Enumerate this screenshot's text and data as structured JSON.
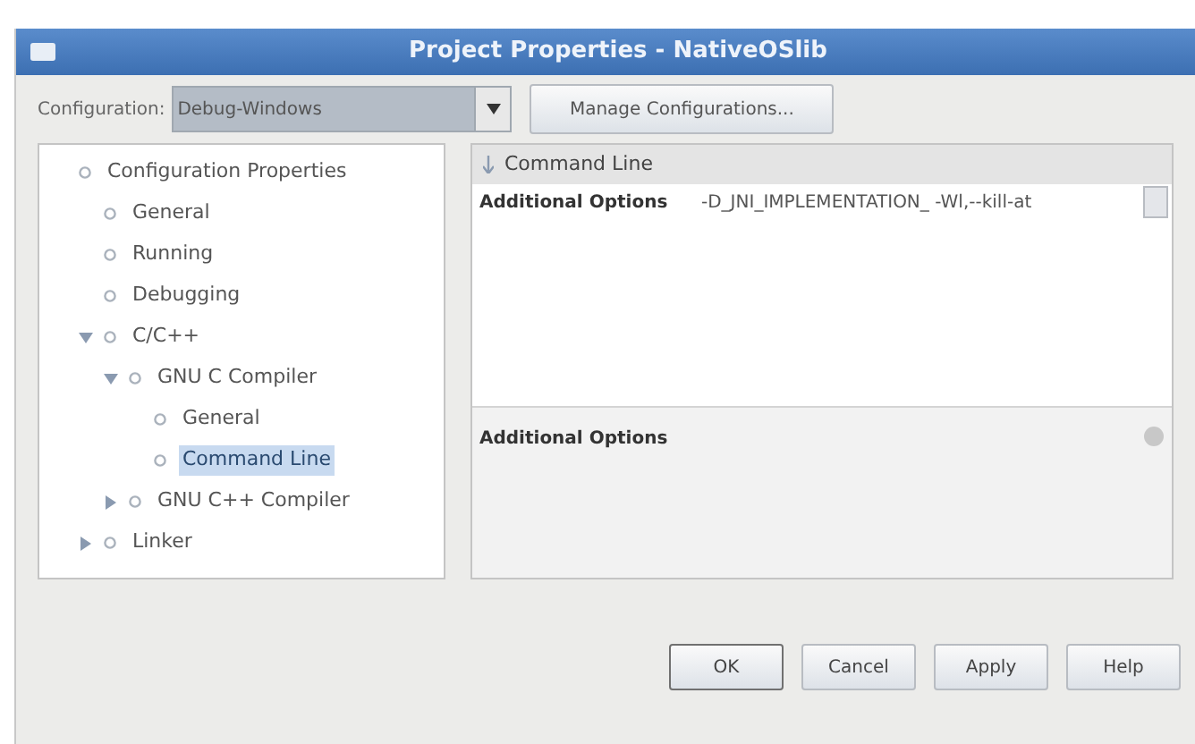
{
  "window": {
    "title": "Project Properties - NativeOSlib"
  },
  "configuration": {
    "label": "Configuration:",
    "value": "Debug-Windows",
    "manage_button": "Manage Configurations..."
  },
  "tree": [
    {
      "label": "Configuration Properties",
      "selected": false,
      "children": [
        {
          "label": "General",
          "selected": false
        },
        {
          "label": "Running",
          "selected": false
        },
        {
          "label": "Debugging",
          "selected": false
        },
        {
          "label": "C/C++",
          "selected": false,
          "expanded": true,
          "children": [
            {
              "label": "GNU C Compiler",
              "selected": false,
              "expanded": true,
              "children": [
                {
                  "label": "General",
                  "selected": false
                },
                {
                  "label": "Command Line",
                  "selected": true
                }
              ]
            },
            {
              "label": "GNU C++ Compiler",
              "selected": false,
              "expanded": false
            }
          ]
        },
        {
          "label": "Linker",
          "selected": false,
          "expanded": false
        }
      ]
    }
  ],
  "properties": {
    "section": "Command Line",
    "rows": [
      {
        "name": "Additional Options",
        "value": "-D_JNI_IMPLEMENTATION_ -Wl,--kill-at"
      }
    ]
  },
  "description": {
    "title": "Additional Options"
  },
  "buttons": [
    "OK",
    "Cancel",
    "Apply",
    "Help"
  ]
}
